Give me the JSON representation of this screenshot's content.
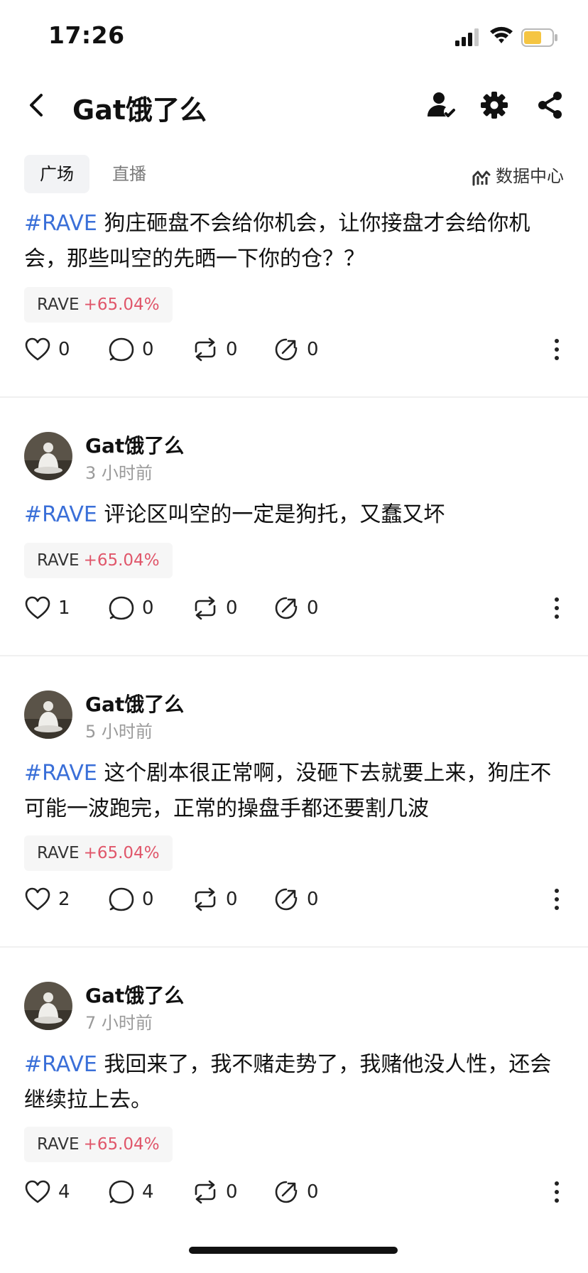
{
  "status": {
    "time": "17:26"
  },
  "nav": {
    "title": "Gat饿了么"
  },
  "tabs": {
    "square": "广场",
    "live": "直播",
    "data_center": "数据中心"
  },
  "posts": [
    {
      "hashtag": "#RAVE",
      "text": " 狗庄砸盘不会给你机会，让你接盘才会给你机会，那些叫空的先晒一下你的仓？？",
      "tag_symbol": "RAVE",
      "tag_change": "+65.04%",
      "likes": "0",
      "comments": "0",
      "reposts": "0",
      "shares": "0"
    },
    {
      "author": "Gat饿了么",
      "time_ago": "3 小时前",
      "hashtag": "#RAVE",
      "text": " 评论区叫空的一定是狗托，又蠢又坏",
      "tag_symbol": "RAVE",
      "tag_change": "+65.04%",
      "likes": "1",
      "comments": "0",
      "reposts": "0",
      "shares": "0"
    },
    {
      "author": "Gat饿了么",
      "time_ago": "5 小时前",
      "hashtag": "#RAVE",
      "text": " 这个剧本很正常啊，没砸下去就要上来，狗庄不可能一波跑完，正常的操盘手都还要割几波",
      "tag_symbol": "RAVE",
      "tag_change": "+65.04%",
      "likes": "2",
      "comments": "0",
      "reposts": "0",
      "shares": "0"
    },
    {
      "author": "Gat饿了么",
      "time_ago": "7 小时前",
      "hashtag": "#RAVE",
      "text": " 我回来了，我不赌走势了，我赌他没人性，还会继续拉上去。",
      "tag_symbol": "RAVE",
      "tag_change": "+65.04%",
      "likes": "4",
      "comments": "4",
      "reposts": "0",
      "shares": "0"
    }
  ],
  "colors": {
    "hashtag": "#3a6fd8",
    "positive_change": "#e0566a",
    "battery": "#f5c542"
  }
}
